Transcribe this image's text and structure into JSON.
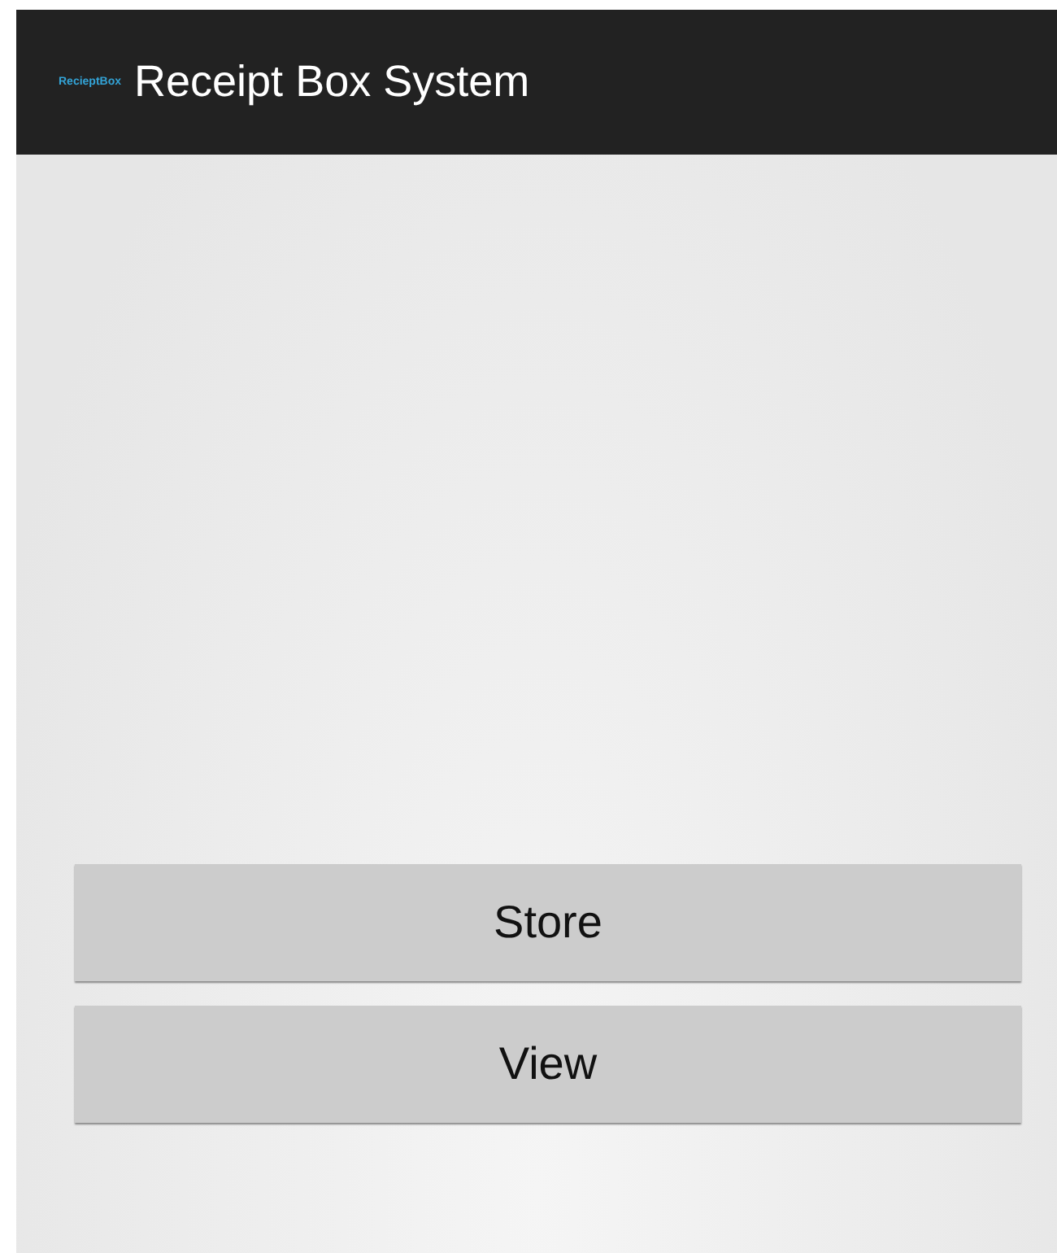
{
  "action_bar": {
    "logo": "RecieptBox",
    "title": "Receipt Box System"
  },
  "buttons": [
    "Store",
    "View"
  ]
}
